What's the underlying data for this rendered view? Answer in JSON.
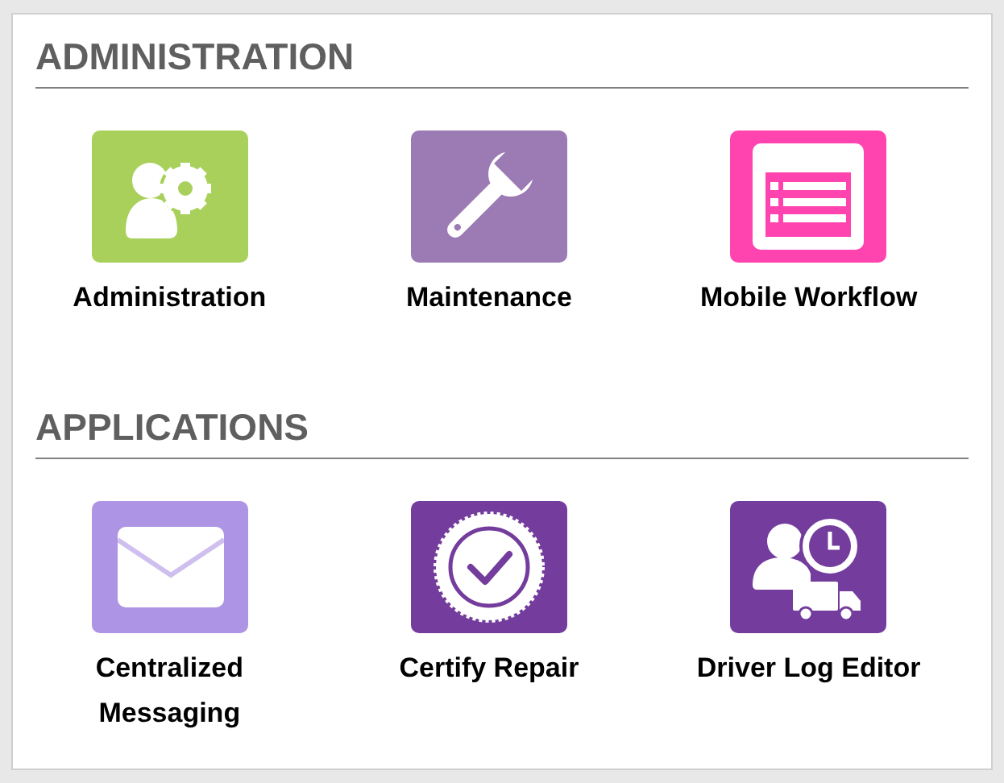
{
  "sections": [
    {
      "title": "ADMINISTRATION",
      "tiles": [
        {
          "label": "Administration",
          "kind": "user-gear",
          "color": "#a8d05a"
        },
        {
          "label": "Maintenance",
          "kind": "wrench",
          "color": "#9c7bb5"
        },
        {
          "label": "Mobile Workflow",
          "kind": "form",
          "color": "#ff44b0"
        }
      ]
    },
    {
      "title": "APPLICATIONS",
      "tiles": [
        {
          "label": "Centralized Messaging",
          "kind": "envelope",
          "color": "#ae94e4"
        },
        {
          "label": "Certify Repair",
          "kind": "seal-check",
          "color": "#743c9c"
        },
        {
          "label": "Driver Log Editor",
          "kind": "user-clock-truck",
          "color": "#743c9c"
        }
      ]
    }
  ]
}
